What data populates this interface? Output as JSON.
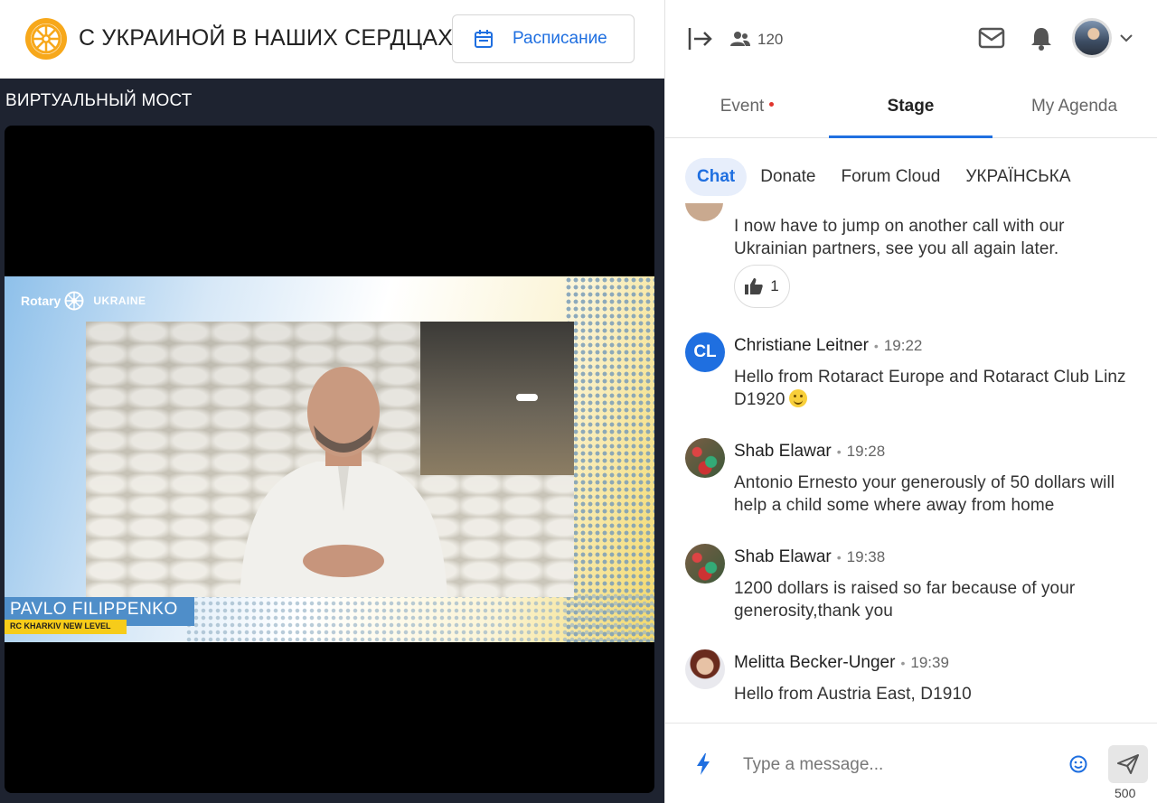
{
  "header": {
    "event_title": "С УКРАИНОЙ В НАШИХ СЕРДЦАХ",
    "schedule_label": "Расписание"
  },
  "stage": {
    "name": "ВИРТУАЛЬНЫЙ МОСТ",
    "video": {
      "brand": "Rotary",
      "brand_region": "UKRAINE",
      "speaker_name": "PAVLO FILIPPENKO",
      "speaker_club": "RC KHARKIV NEW LEVEL"
    }
  },
  "right_header": {
    "attendee_count": "120",
    "icons": [
      "exit-icon",
      "people-icon",
      "mail-icon",
      "bell-icon",
      "avatar",
      "chevron-down-icon"
    ]
  },
  "main_tabs": [
    {
      "label": "Event",
      "has_dot": true
    },
    {
      "label": "Stage",
      "active": true
    },
    {
      "label": "My Agenda"
    }
  ],
  "sub_tabs": [
    {
      "label": "Chat",
      "active": true
    },
    {
      "label": "Donate"
    },
    {
      "label": "Forum Cloud"
    },
    {
      "label": "УКРАЇНСЬКА"
    }
  ],
  "chat": {
    "messages": [
      {
        "author": "",
        "time": "",
        "text": "I now have to jump on another call with our Ukrainian partners, see you all again later.",
        "reaction_count": "1"
      },
      {
        "author": "Christiane Leitner",
        "initials": "CL",
        "time": "19:22",
        "text": "Hello from Rotaract Europe and Rotaract Club Linz D1920"
      },
      {
        "author": "Shab Elawar",
        "time": "19:28",
        "text": "Antonio Ernesto your generously of 50 dollars will help a child some where away from home"
      },
      {
        "author": "Shab Elawar",
        "time": "19:38",
        "text": "1200 dollars is raised so far because of your generosity,thank you"
      },
      {
        "author": "Melitta Becker-Unger",
        "time": "19:39",
        "text": "Hello from Austria East, D1910"
      }
    ]
  },
  "composer": {
    "placeholder": "Type a message...",
    "char_limit": "500"
  },
  "colors": {
    "accent": "#1f6fe0",
    "stage_bg": "#1e2330",
    "event_dot": "#e0342c",
    "name_plate": "#4f8ec9",
    "club_plate": "#f6cc1a"
  }
}
